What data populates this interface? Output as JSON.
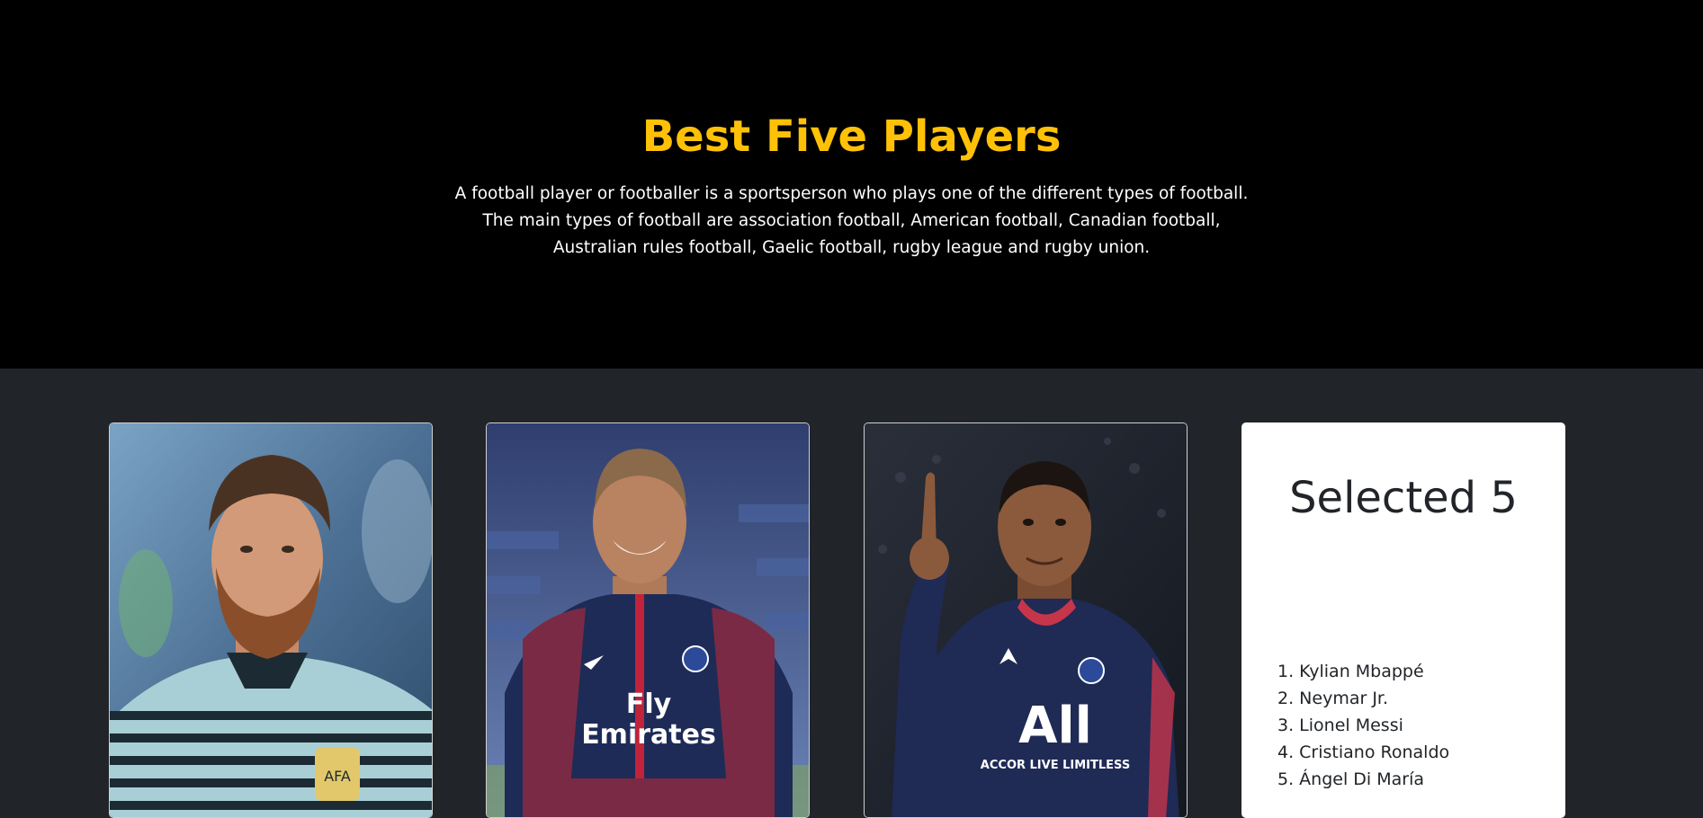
{
  "hero": {
    "title": "Best Five Players",
    "description": "A football player or footballer is a sportsperson who plays one of the different types of football.\nThe main types of football are association football, American football, Canadian football,\nAustralian rules football, Gaelic football, rugby league and rugby union."
  },
  "players": [
    {
      "name": "Lionel Messi",
      "photo": "player-photo"
    },
    {
      "name": "Neymar Jr.",
      "photo": "player-photo"
    },
    {
      "name": "Kylian Mbappé",
      "photo": "player-photo"
    }
  ],
  "selected": {
    "title": "Selected 5",
    "items": [
      "1. Kylian Mbappé",
      "2. Neymar Jr.",
      "3. Lionel Messi",
      "4. Cristiano Ronaldo",
      "5. Ángel Di María"
    ]
  },
  "colors": {
    "hero_bg": "#000000",
    "accent": "#ffc107",
    "section_bg": "#212529",
    "card_bg": "#ffffff"
  }
}
